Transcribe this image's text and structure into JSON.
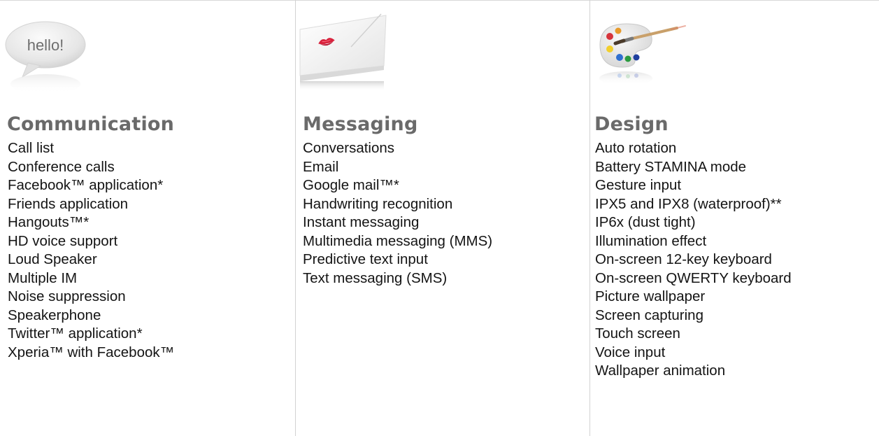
{
  "columns": [
    {
      "icon": "hello-speech-bubble-icon",
      "icon_text": "hello!",
      "title": "Communication",
      "items": [
        "Call list",
        "Conference calls",
        "Facebook™ application*",
        "Friends application",
        "Hangouts™*",
        "HD voice support",
        "Loud Speaker",
        "Multiple IM",
        "Noise suppression",
        "Speakerphone",
        "Twitter™ application*",
        "Xperia™ with Facebook™"
      ]
    },
    {
      "icon": "envelope-kiss-icon",
      "title": "Messaging",
      "items": [
        "Conversations",
        "Email",
        "Google mail™*",
        "Handwriting recognition",
        "Instant messaging",
        "Multimedia messaging (MMS)",
        "Predictive text input",
        "Text messaging (SMS)"
      ]
    },
    {
      "icon": "paint-palette-icon",
      "title": "Design",
      "items": [
        "Auto rotation",
        "Battery STAMINA mode",
        "Gesture input",
        "IPX5 and IPX8 (waterproof)**",
        "IP6x (dust tight)",
        "Illumination effect",
        "On-screen 12-key keyboard",
        "On-screen QWERTY keyboard",
        "Picture wallpaper",
        "Screen capturing",
        "Touch screen",
        "Voice input",
        "Wallpaper animation"
      ]
    }
  ],
  "colors": {
    "heading": "#6a6a6a",
    "text": "#141414",
    "divider": "#d2d2d2",
    "background": "#ffffff"
  }
}
